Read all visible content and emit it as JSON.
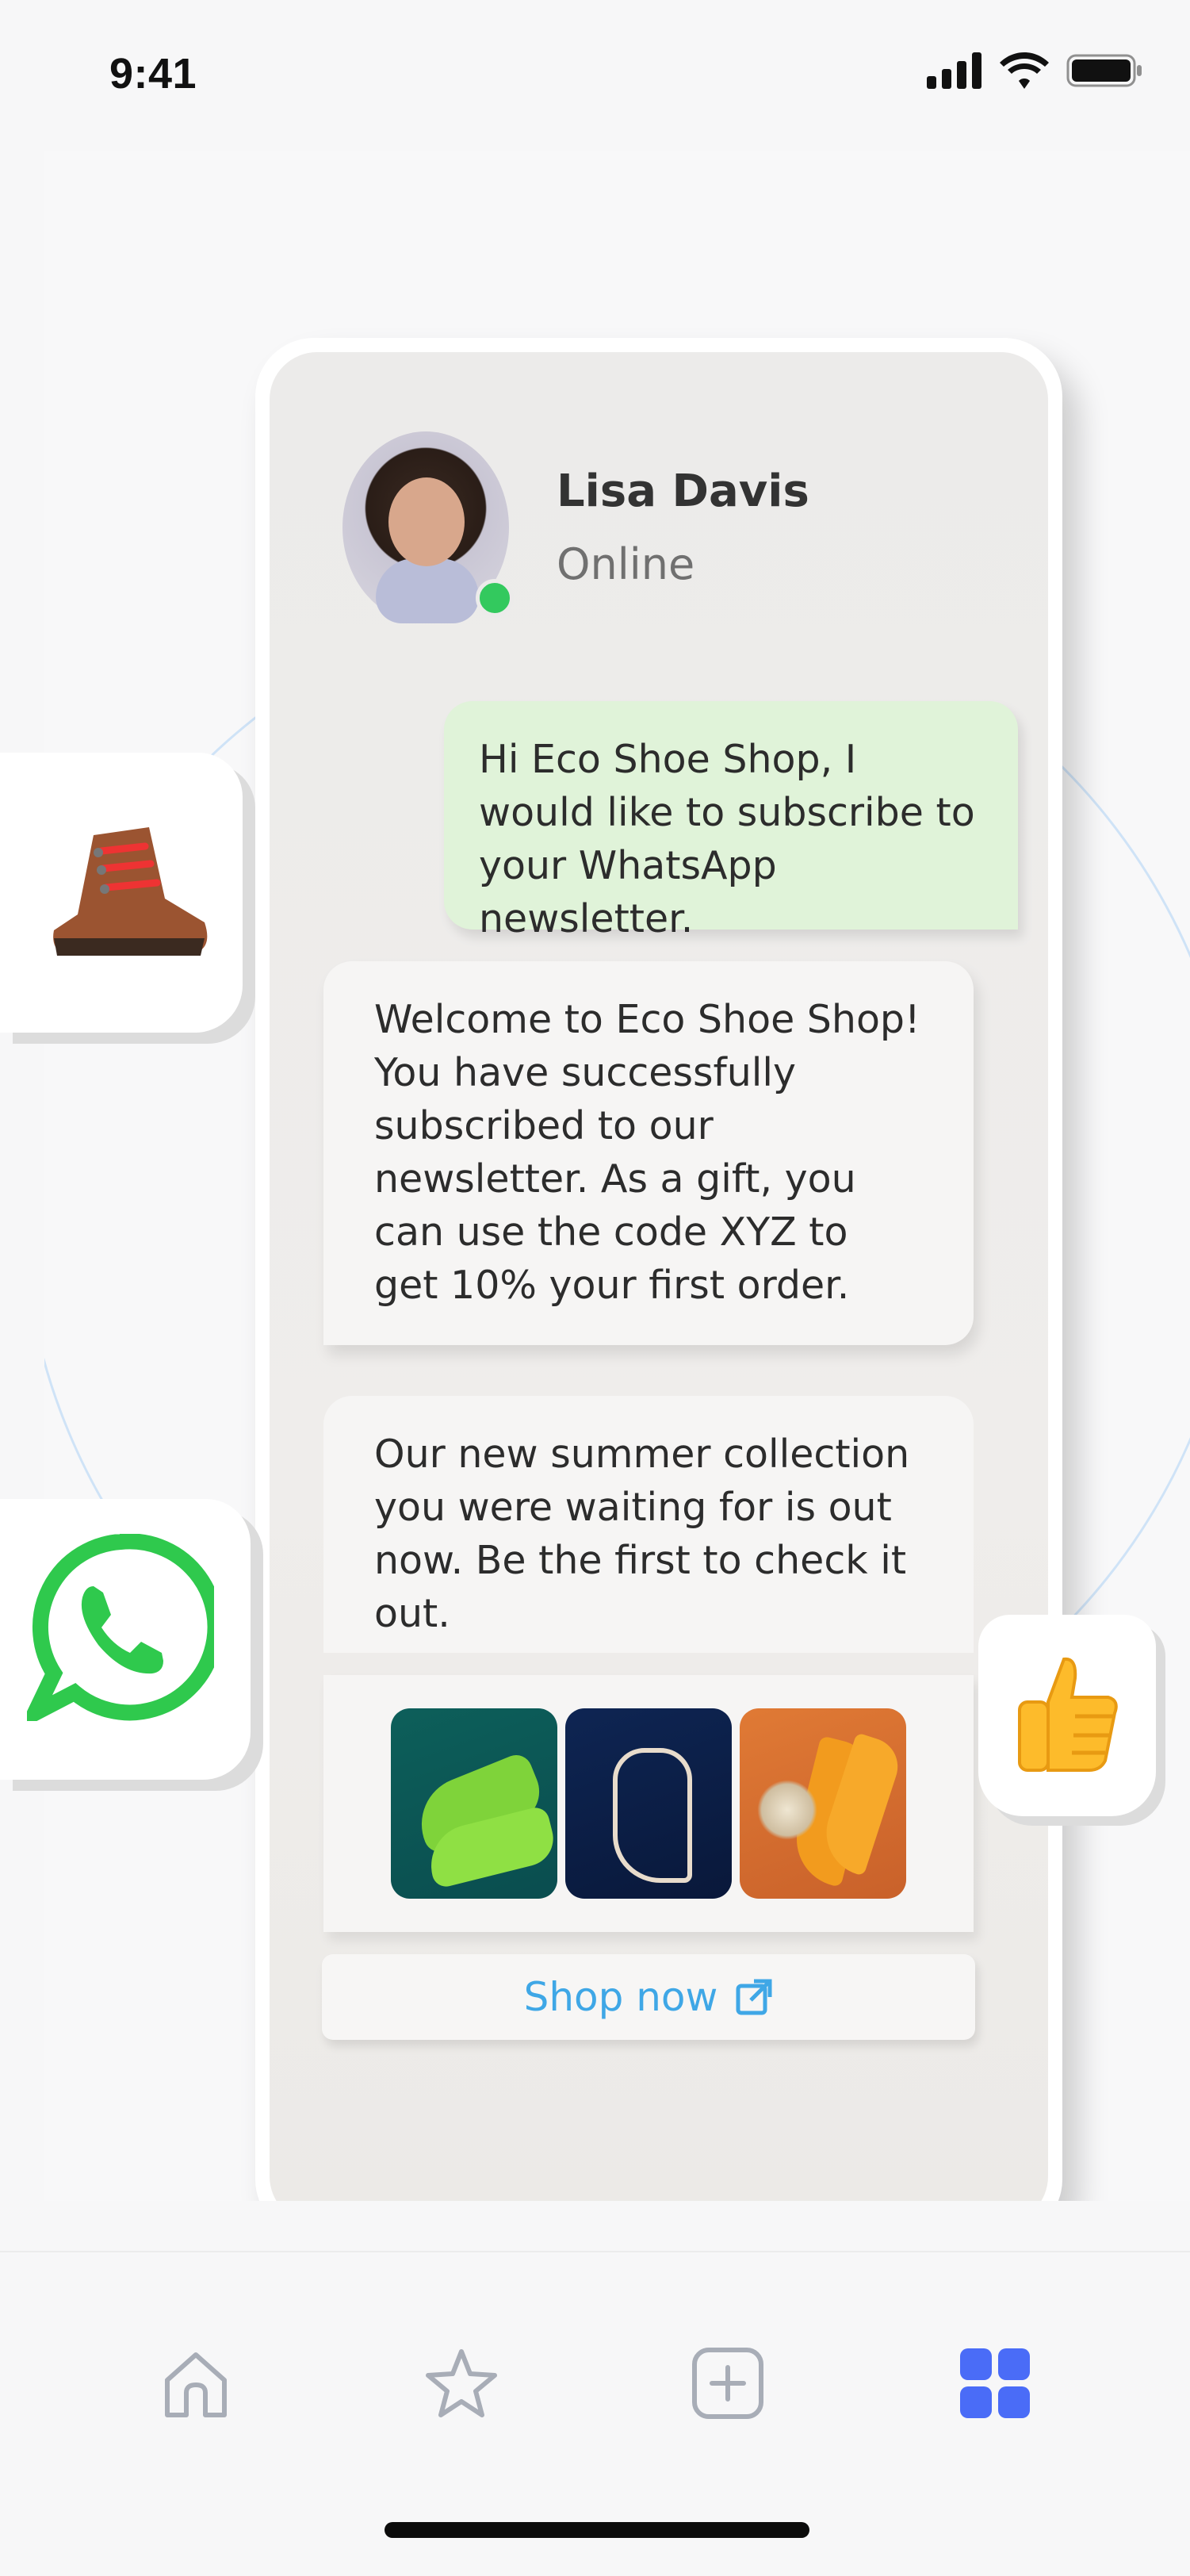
{
  "status_bar": {
    "time": "9:41",
    "icons": [
      "cellular-signal-icon",
      "wifi-icon",
      "battery-icon"
    ]
  },
  "chat": {
    "contact": {
      "name": "Lisa Davis",
      "status": "Online",
      "status_color": "#33c95e"
    },
    "messages": [
      {
        "direction": "outgoing",
        "text": "Hi Eco Shoe Shop, I would like to subscribe to your WhatsApp newsletter."
      },
      {
        "direction": "incoming",
        "text": "Welcome to Eco Shoe Shop! You have successfully subscribed to our newsletter. As a gift, you can use the code XYZ to get 10% your first order."
      },
      {
        "direction": "incoming",
        "text": "Our new summer collection you were waiting for is out now. Be the first to check it out."
      }
    ],
    "gallery": [
      "green-sneakers-image",
      "white-sandals-image",
      "orange-heels-image"
    ],
    "cta_label": "Shop now",
    "cta_icon": "external-link-icon"
  },
  "floating_cards": [
    "hiking-boot-emoji",
    "whatsapp-logo",
    "thumbs-up-emoji"
  ],
  "tab_bar": {
    "tabs": [
      {
        "icon": "home-icon",
        "active": false
      },
      {
        "icon": "star-icon",
        "active": false
      },
      {
        "icon": "add-square-icon",
        "active": false
      },
      {
        "icon": "grid-icon",
        "active": true
      }
    ],
    "active_color": "#4a6cf7",
    "inactive_color": "#a8adb7"
  }
}
